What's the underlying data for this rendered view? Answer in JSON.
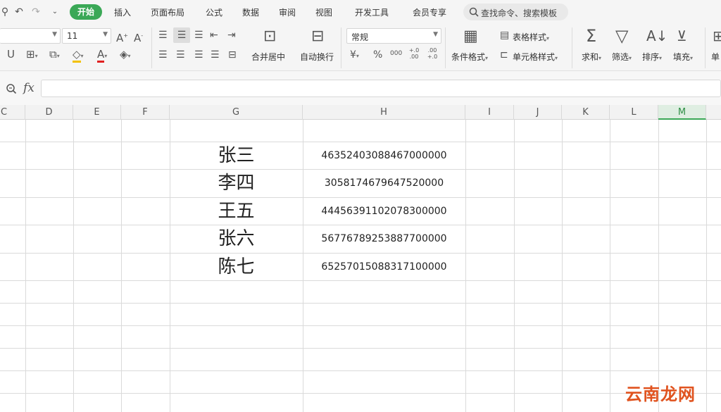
{
  "menu": {
    "items": [
      "开始",
      "插入",
      "页面布局",
      "公式",
      "数据",
      "审阅",
      "视图",
      "开发工具",
      "会员专享"
    ],
    "search_placeholder": "查找命令、搜索模板"
  },
  "ribbon": {
    "font_size": "11",
    "merge_label": "合并居中",
    "wrap_label": "自动换行",
    "number_format": "常规",
    "conditional_format_label": "条件格式",
    "table_style_label": "表格样式",
    "cell_style_label": "单元格样式",
    "sum_label": "求和",
    "filter_label": "筛选",
    "sort_label": "排序",
    "fill_label": "填充",
    "cell_label": "单",
    "currency_symbol": "¥",
    "percent_symbol": "%",
    "thousands_symbol": "000",
    "increase_decimal": "+.0 .00",
    "decrease_decimal": ".00 +.0"
  },
  "formula_bar": {
    "fx_label": "fx",
    "value": ""
  },
  "columns": [
    "C",
    "D",
    "E",
    "F",
    "G",
    "H",
    "I",
    "J",
    "K",
    "L",
    "M"
  ],
  "active_column": "M",
  "rows": [
    {
      "name": "张三",
      "number": "46352403088467000000"
    },
    {
      "name": "李四",
      "number": "3058174679647520000"
    },
    {
      "name": "王五",
      "number": "44456391102078300000"
    },
    {
      "name": "张六",
      "number": "56776789253887700000"
    },
    {
      "name": "陈七",
      "number": "65257015088317100000"
    }
  ],
  "watermark": "云南龙网",
  "colors": {
    "accent": "#3aa856",
    "watermark": "#e0531f"
  }
}
